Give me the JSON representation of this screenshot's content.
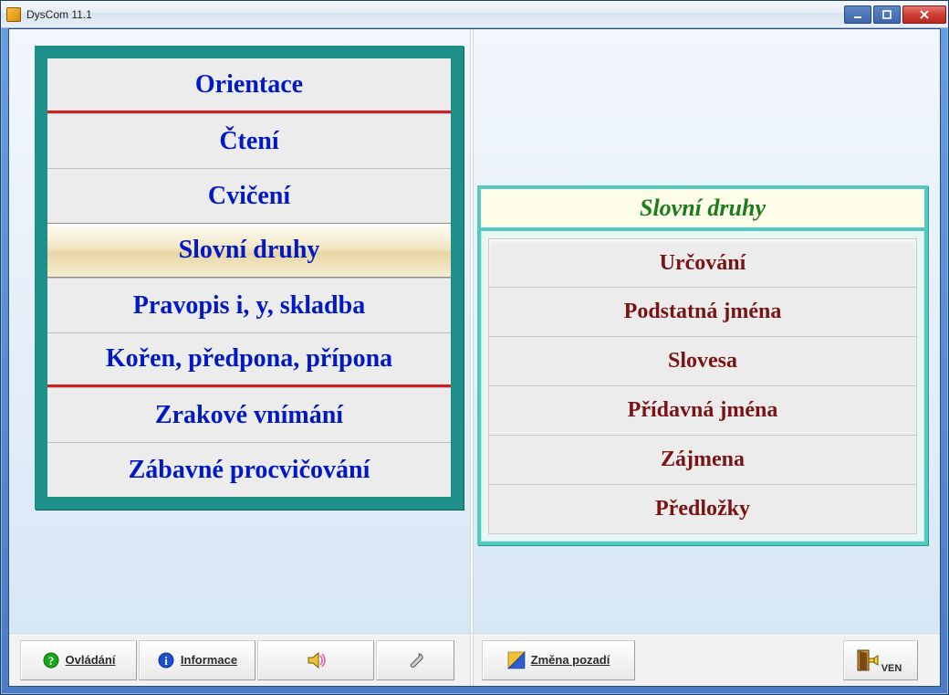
{
  "window": {
    "title": "DysCom 11.1"
  },
  "main_menu": {
    "items": [
      {
        "label": "Orientace"
      },
      {
        "label": "Čtení"
      },
      {
        "label": "Cvičení"
      },
      {
        "label": "Slovní druhy"
      },
      {
        "label": "Pravopis i, y, skladba"
      },
      {
        "label": "Kořen, předpona, přípona"
      },
      {
        "label": "Zrakové vnímání"
      },
      {
        "label": "Zábavné procvičování"
      }
    ],
    "selected_index": 3
  },
  "sub_menu": {
    "title": "Slovní druhy",
    "items": [
      {
        "label": "Určování"
      },
      {
        "label": "Podstatná jména"
      },
      {
        "label": "Slovesa"
      },
      {
        "label": "Přídavná jména"
      },
      {
        "label": "Zájmena"
      },
      {
        "label": "Předložky"
      }
    ]
  },
  "toolbar": {
    "ovladani": "Ovládání",
    "informace": "Informace",
    "zmena_pozadi": "Změna pozadí",
    "ven": "VEN"
  }
}
